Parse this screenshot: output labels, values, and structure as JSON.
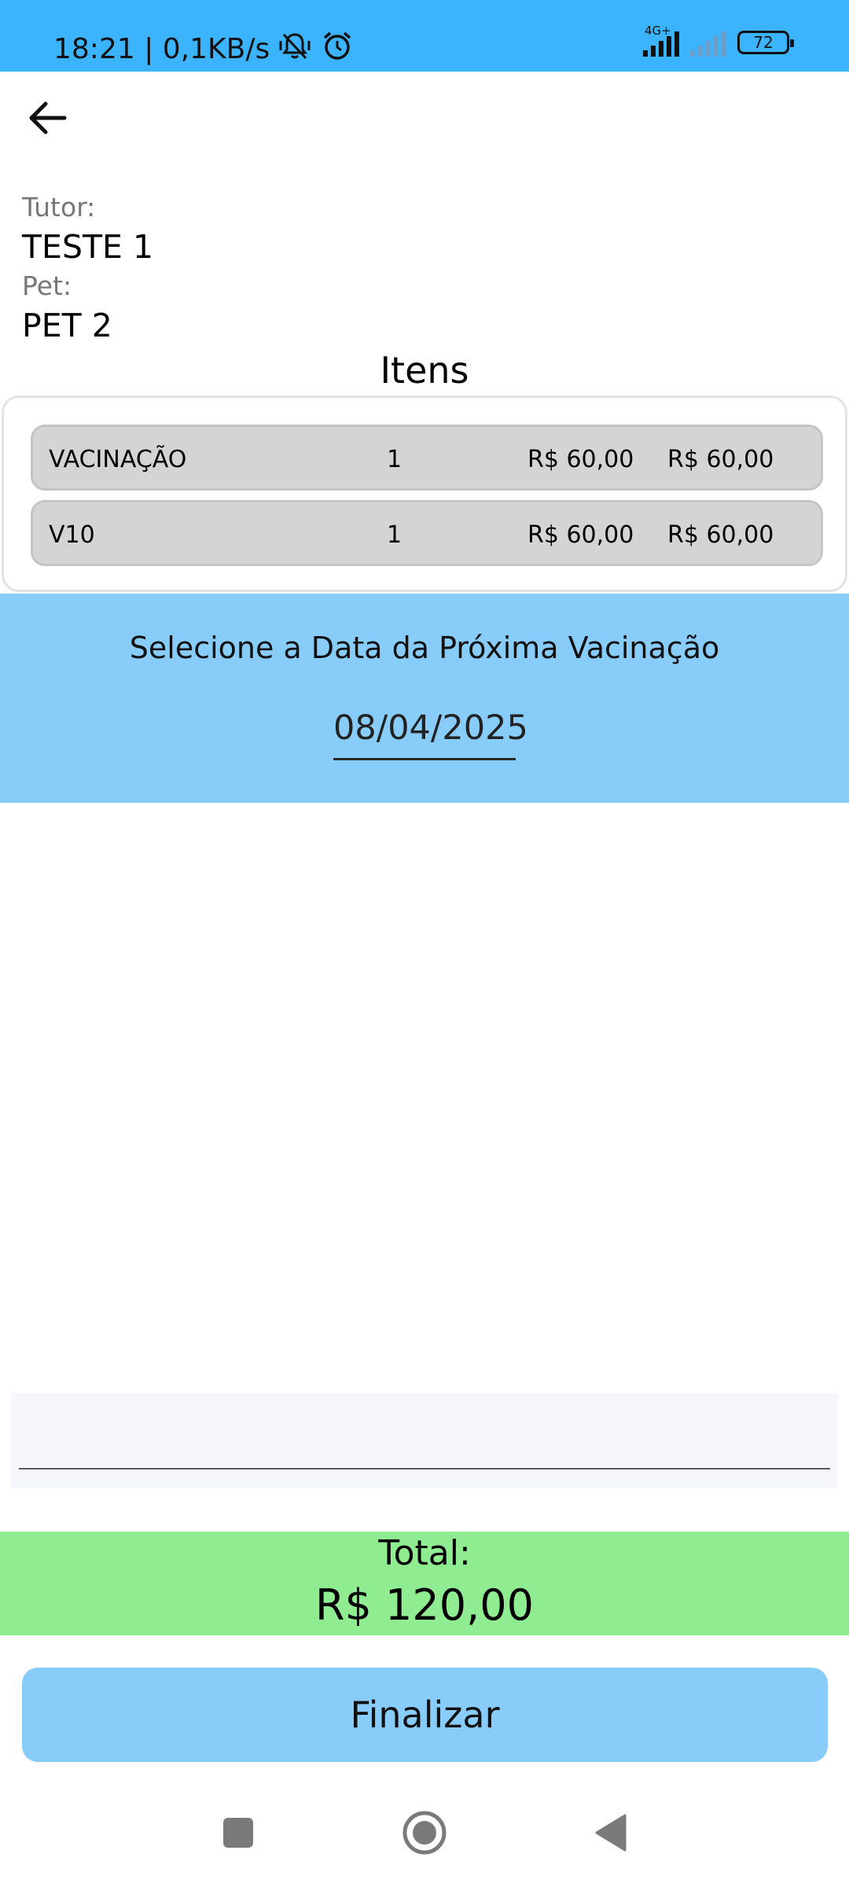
{
  "status_bar": {
    "time_speed": "18:21 | 0,1KB/s",
    "network_type": "4G+",
    "battery_level": "72",
    "icons": [
      "mute-vibrate-icon",
      "alarm-icon",
      "signal-4g-icon",
      "signal-dim-icon",
      "battery-icon"
    ]
  },
  "header": {
    "back_icon": "arrow-left-icon"
  },
  "info": {
    "tutor_label": "Tutor:",
    "tutor_value": "TESTE 1",
    "pet_label": "Pet:",
    "pet_value": "PET 2"
  },
  "items": {
    "title": "Itens",
    "rows": [
      {
        "name": "VACINAÇÃO",
        "qty": "1",
        "unit_price": "R$ 60,00",
        "total": "R$ 60,00"
      },
      {
        "name": "V10",
        "qty": "1",
        "unit_price": "R$ 60,00",
        "total": "R$ 60,00"
      }
    ]
  },
  "vaccination": {
    "title": "Selecione a Data da Próxima Vacinação",
    "date": "08/04/2025"
  },
  "observation": {
    "value": "",
    "placeholder": ""
  },
  "total": {
    "label": "Total:",
    "value": "R$ 120,00"
  },
  "actions": {
    "finalize_label": "Finalizar"
  },
  "colors": {
    "status_bar": "#3bb4fd",
    "accent_blue": "#88cdfa",
    "total_green": "#90ec90",
    "item_row": "#d4d4d4"
  }
}
